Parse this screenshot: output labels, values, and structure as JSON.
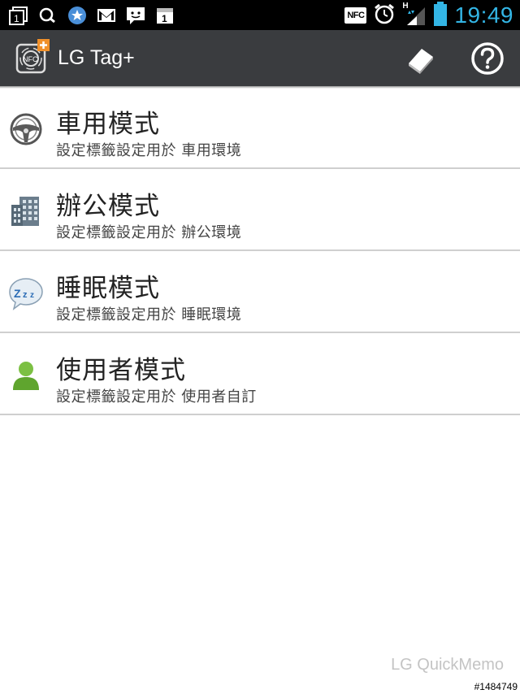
{
  "status_bar": {
    "nfc_label": "NFC",
    "network_label": "H",
    "time": "19:49",
    "accent_color": "#33b5e5"
  },
  "action_bar": {
    "title": "LG Tag+",
    "logo_icon": "nfc-tag-icon",
    "eraser_icon": "eraser-icon",
    "help_icon": "help-icon"
  },
  "modes": [
    {
      "icon": "steering-wheel-icon",
      "title": "車用模式",
      "subtitle": "設定標籤設定用於 車用環境"
    },
    {
      "icon": "office-building-icon",
      "title": "辦公模式",
      "subtitle": "設定標籤設定用於 辦公環境"
    },
    {
      "icon": "sleep-bubble-icon",
      "title": "睡眠模式",
      "subtitle": "設定標籤設定用於 睡眠環境"
    },
    {
      "icon": "user-icon",
      "title": "使用者模式",
      "subtitle": "設定標籤設定用於 使用者自訂"
    }
  ],
  "footer": {
    "watermark": "LG QuickMemo",
    "id": "#1484749"
  }
}
